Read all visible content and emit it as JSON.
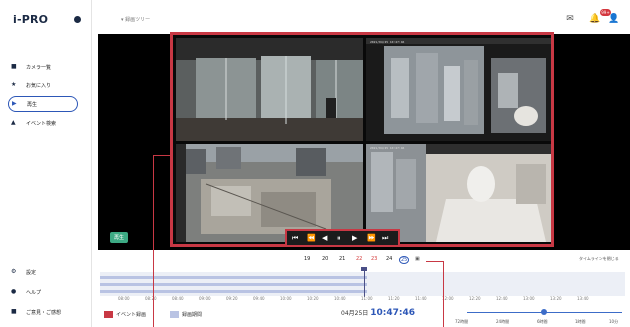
{
  "app": {
    "logo": "i-PRO",
    "breadcrumb": "▾ 録画ツリー"
  },
  "sidebar": {
    "items": [
      {
        "icon": "camera-icon",
        "glyph": "■",
        "label": "カメラ一覧"
      },
      {
        "icon": "star-icon",
        "glyph": "★",
        "label": "お気に入り"
      },
      {
        "icon": "play-icon",
        "glyph": "▶",
        "label": "再生"
      },
      {
        "icon": "person-icon",
        "glyph": "▲",
        "label": "イベント検索"
      }
    ],
    "bottom": [
      {
        "icon": "gear-icon",
        "glyph": "⚙",
        "label": "設定"
      },
      {
        "icon": "help-icon",
        "glyph": "●",
        "label": "ヘルプ"
      },
      {
        "icon": "feedback-icon",
        "glyph": "■",
        "label": "ご意見・ご感想"
      }
    ]
  },
  "header": {
    "notification_badge": "99+"
  },
  "viewer": {
    "play_label": "再生",
    "cameras": [
      {
        "timestamp": ""
      },
      {
        "timestamp": "2021/04/25 10:47:46"
      },
      {
        "timestamp": ""
      },
      {
        "timestamp": "2021/04/25 10:47:46"
      }
    ],
    "controls": [
      "⏮",
      "⏪",
      "◀",
      "⏸",
      "▶",
      "⏩",
      "⏭"
    ]
  },
  "timeline": {
    "days": [
      {
        "label": "19",
        "color": "#222222"
      },
      {
        "label": "20",
        "color": "#222222"
      },
      {
        "label": "21",
        "color": "#222222"
      },
      {
        "label": "22",
        "color": "#d43a3a"
      },
      {
        "label": "23",
        "color": "#d43a3a"
      },
      {
        "label": "24",
        "color": "#222222"
      },
      {
        "label": "25",
        "color": "#2d57b7"
      }
    ],
    "ticks": [
      "08:00",
      "08:20",
      "08:40",
      "09:00",
      "09:20",
      "09:40",
      "10:00",
      "10:20",
      "10:40",
      "11:00",
      "11:20",
      "11:40",
      "12:00",
      "12:20",
      "12:40",
      "13:00",
      "13:20",
      "13:40"
    ],
    "options_label": "タイムラインを閉じる",
    "legend_event": "イベント録画",
    "legend_period": "録画期間",
    "date": "04月25日",
    "time": "10:47:46",
    "zoom_labels": [
      "72時間",
      "24時間",
      "6時間",
      "1時間",
      "10分"
    ]
  },
  "colors": {
    "accent": "#c83844",
    "brand": "#1b2a44",
    "link": "#2d57b7",
    "play_green": "#3daa84"
  }
}
